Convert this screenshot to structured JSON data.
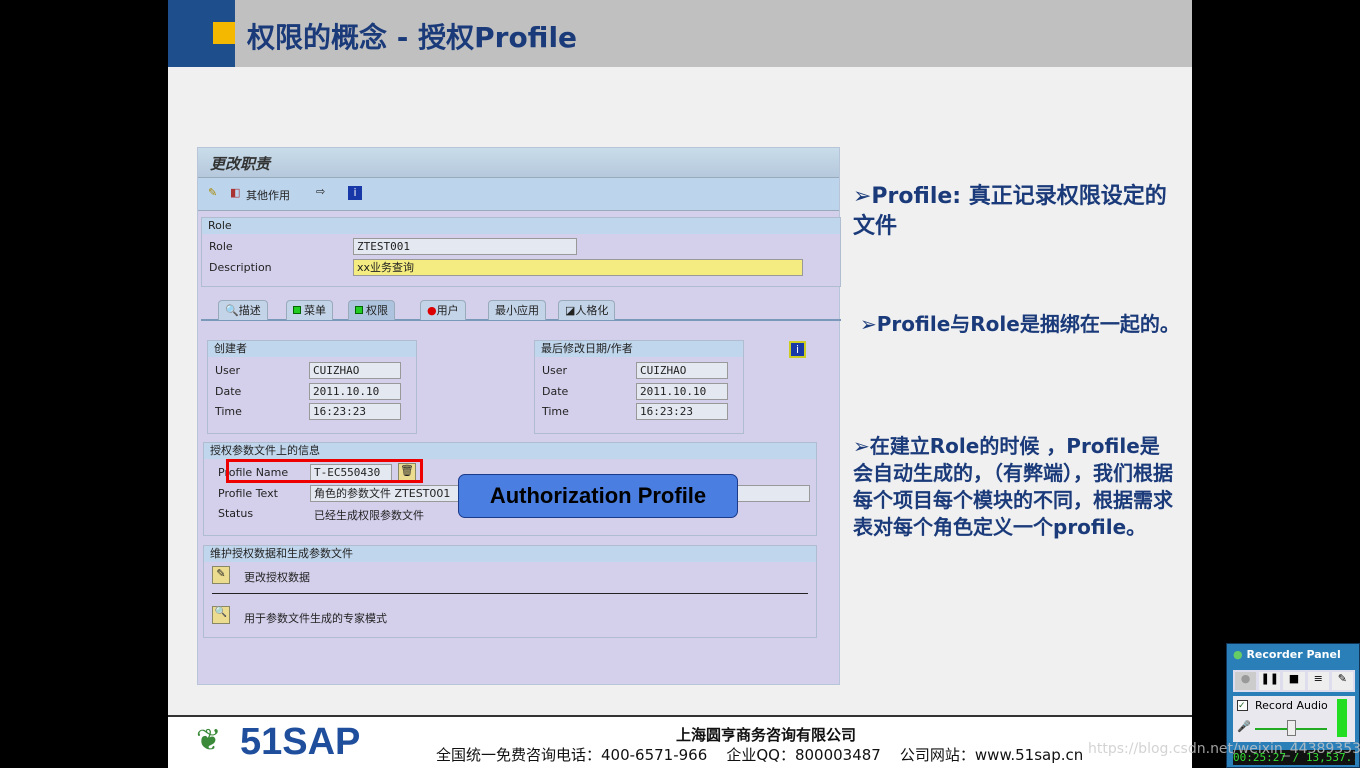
{
  "slide": {
    "title": "权限的概念 - 授权Profile"
  },
  "sap": {
    "window_title": "更改职责",
    "toolbar": {
      "other_actions": "其他作用"
    },
    "role_group": {
      "header": "Role",
      "role_label": "Role",
      "role_value": "ZTEST001",
      "desc_label": "Description",
      "desc_value": "xx业务查询"
    },
    "tabs": [
      {
        "label": "描述"
      },
      {
        "label": "菜单"
      },
      {
        "label": "权限"
      },
      {
        "label": "用户"
      },
      {
        "label": "最小应用"
      },
      {
        "label": "人格化"
      }
    ],
    "creator": {
      "header": "创建者",
      "user_label": "User",
      "user": "CUIZHAO",
      "date_label": "Date",
      "date": "2011.10.10",
      "time_label": "Time",
      "time": "16:23:23"
    },
    "modified": {
      "header": "最后修改日期/作者",
      "user_label": "User",
      "user": "CUIZHAO",
      "date_label": "Date",
      "date": "2011.10.10",
      "time_label": "Time",
      "time": "16:23:23"
    },
    "profile": {
      "header": "授权参数文件上的信息",
      "name_label": "Profile Name",
      "name": "T-EC550430",
      "text_label": "Profile Text",
      "text": "角色的参数文件 ZTEST001",
      "status_label": "Status",
      "status": "已经生成权限参数文件"
    },
    "maintain": {
      "header": "维护授权数据和生成参数文件",
      "change": "更改授权数据",
      "expert": "用于参数文件生成的专家模式"
    },
    "callout": "Authorization Profile"
  },
  "notes": [
    "➢Profile: 真正记录权限设定的文件",
    "➢Profile与Role是捆绑在一起的。",
    "➢在建立Role的时候 ，Profile是会自动生成的，（有弊端），我们根据每个项目每个模块的不同，根据需求表对每个角色定义一个profile。"
  ],
  "footer": {
    "logo": "51SAP",
    "company": "上海圆亨商务咨询有限公司",
    "contact": "全国统一免费咨询电话：400-6571-966    企业QQ：800003487    公司网站：www.51sap.cn"
  },
  "recorder": {
    "title": "Recorder Panel",
    "record_audio": "Record Audio",
    "timer": "00:25:27 / 13,537..."
  },
  "watermark": "https://blog.csdn.net/weixin_44389353"
}
